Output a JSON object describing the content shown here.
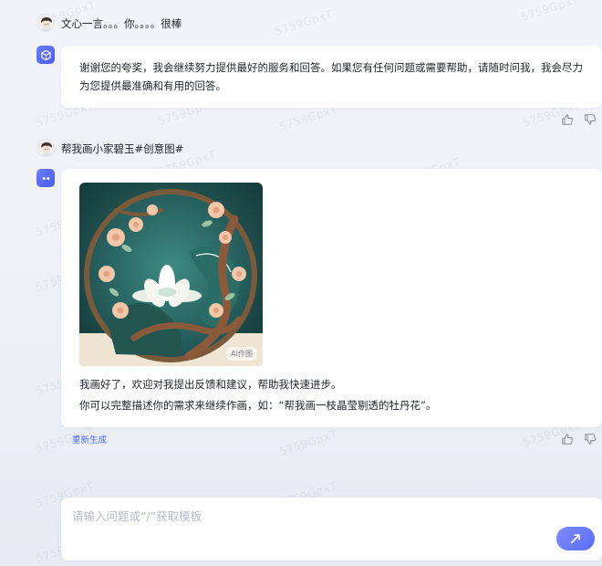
{
  "conversation": [
    {
      "user_text": "文心一言。。。你。。。。很棒",
      "bot_text": "谢谢您的夸奖，我会继续努力提供最好的服务和回答。如果您有任何问题或需要帮助，请随时问我，我会尽力为您提供最准确和有用的回答。"
    },
    {
      "user_text": "帮我画小家碧玉#创意图#",
      "bot_image_badge": "AI作图",
      "bot_line1": "我画好了，欢迎对我提出反馈和建议，帮助我快速进步。",
      "bot_line2": "你可以完整描述你的需求来继续作画，如：“帮我画一枝晶莹剔透的牡丹花”。",
      "regenerate_label": "重新生成"
    }
  ],
  "input": {
    "placeholder": "请输入问题或“/”获取模板",
    "value": ""
  },
  "watermark": "5759GpxT",
  "icons": {
    "feedback_up": "thumbs-up-icon",
    "feedback_down": "thumbs-down-icon",
    "send": "send-icon",
    "bot_avatar_1": "cube-icon",
    "bot_avatar_2": "bot-face-icon"
  },
  "colors": {
    "accent": "#4c6ef5",
    "send_button": "#6a7cff",
    "background": "#f3f4f9"
  }
}
